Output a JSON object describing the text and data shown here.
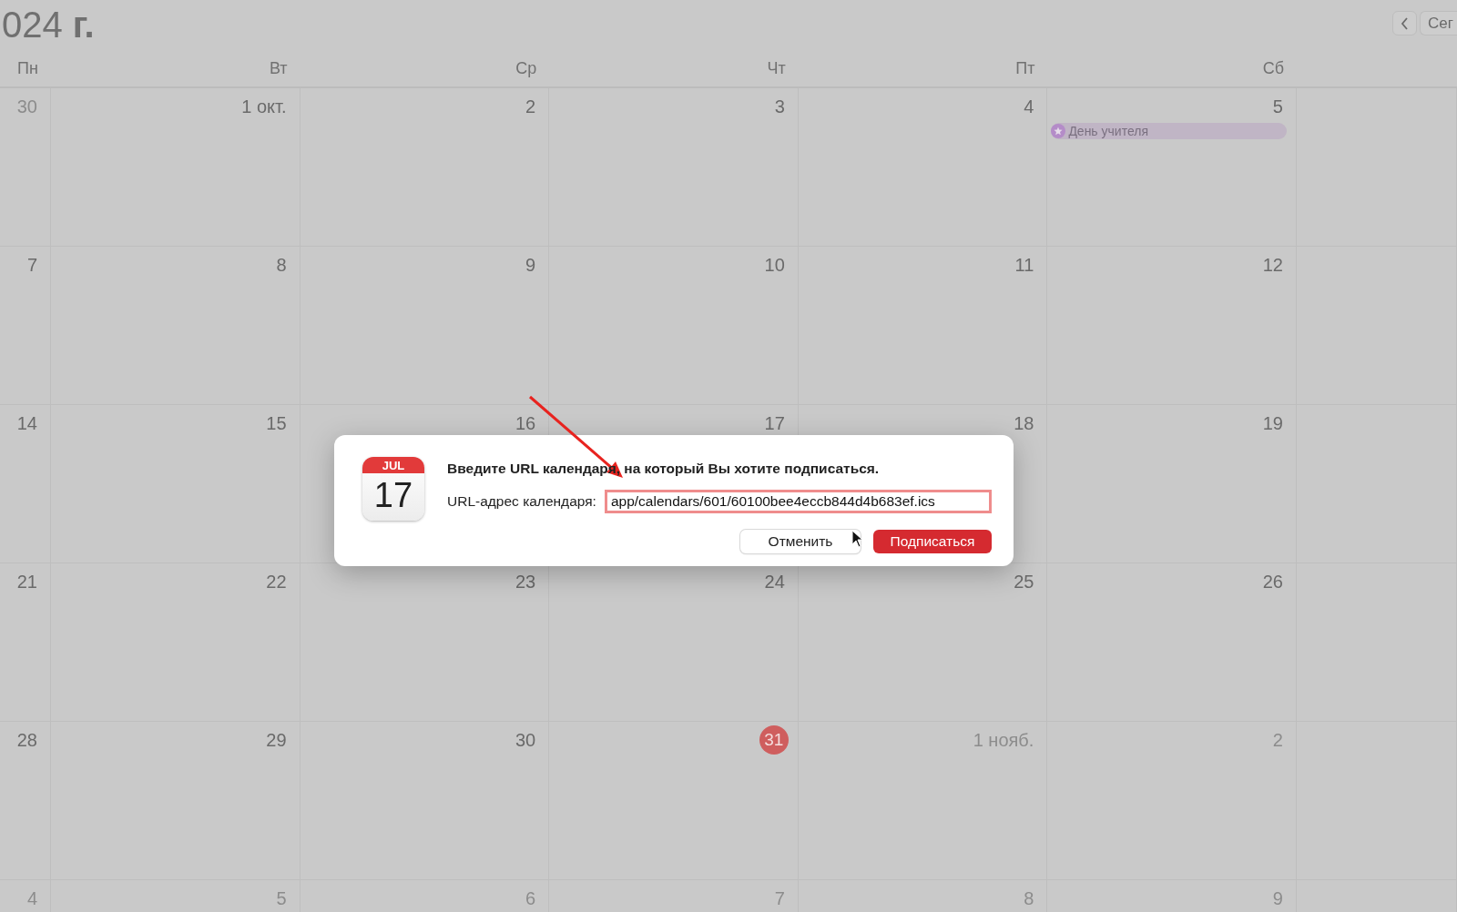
{
  "toolbar": {
    "title": "024 **г.**",
    "today_button": "Сег"
  },
  "weekdays": [
    {
      "label": "Пн"
    },
    {
      "label": "Вт"
    },
    {
      "label": "Ср"
    },
    {
      "label": "Чт"
    },
    {
      "label": "Пт"
    },
    {
      "label": "Сб"
    }
  ],
  "weeks": [
    {
      "days": [
        {
          "label": "30",
          "outside": true,
          "today": false
        },
        {
          "label": "1 окт.",
          "outside": false,
          "today": false
        },
        {
          "label": "2",
          "outside": false,
          "today": false
        },
        {
          "label": "3",
          "outside": false,
          "today": false
        },
        {
          "label": "4",
          "outside": false,
          "today": false
        },
        {
          "label": "5",
          "outside": false,
          "today": false,
          "events": [
            {
              "title": "День учителя",
              "color": "#b48cc8"
            }
          ]
        }
      ]
    },
    {
      "days": [
        {
          "label": "7",
          "outside": false,
          "today": false
        },
        {
          "label": "8",
          "outside": false,
          "today": false
        },
        {
          "label": "9",
          "outside": false,
          "today": false
        },
        {
          "label": "10",
          "outside": false,
          "today": false
        },
        {
          "label": "11",
          "outside": false,
          "today": false
        },
        {
          "label": "12",
          "outside": false,
          "today": false
        }
      ]
    },
    {
      "days": [
        {
          "label": "14",
          "outside": false,
          "today": false
        },
        {
          "label": "15",
          "outside": false,
          "today": false
        },
        {
          "label": "16",
          "outside": false,
          "today": false
        },
        {
          "label": "17",
          "outside": false,
          "today": false
        },
        {
          "label": "18",
          "outside": false,
          "today": false
        },
        {
          "label": "19",
          "outside": false,
          "today": false
        }
      ]
    },
    {
      "days": [
        {
          "label": "21",
          "outside": false,
          "today": false
        },
        {
          "label": "22",
          "outside": false,
          "today": false
        },
        {
          "label": "23",
          "outside": false,
          "today": false
        },
        {
          "label": "24",
          "outside": false,
          "today": false
        },
        {
          "label": "25",
          "outside": false,
          "today": false
        },
        {
          "label": "26",
          "outside": false,
          "today": false
        }
      ]
    },
    {
      "days": [
        {
          "label": "28",
          "outside": false,
          "today": false
        },
        {
          "label": "29",
          "outside": false,
          "today": false
        },
        {
          "label": "30",
          "outside": false,
          "today": false
        },
        {
          "label": "31",
          "outside": false,
          "today": true
        },
        {
          "label": "1 нояб.",
          "outside": true,
          "today": false
        },
        {
          "label": "2",
          "outside": true,
          "today": false
        }
      ]
    },
    {
      "days": [
        {
          "label": "4",
          "outside": true,
          "today": false
        },
        {
          "label": "5",
          "outside": true,
          "today": false
        },
        {
          "label": "6",
          "outside": true,
          "today": false
        },
        {
          "label": "7",
          "outside": true,
          "today": false
        },
        {
          "label": "8",
          "outside": true,
          "today": false
        },
        {
          "label": "9",
          "outside": true,
          "today": false
        }
      ]
    }
  ],
  "dialog": {
    "icon": {
      "month": "JUL",
      "day": "17"
    },
    "message": "Введите URL календаря, на который Вы хотите подписаться.",
    "field_label": "URL-адрес календаря:",
    "field_value": "app/calendars/601/60100bee4eccb844d4b683ef.ics",
    "focused": true,
    "buttons": [
      {
        "label": "Отменить",
        "kind": "secondary"
      },
      {
        "label": "Подписаться",
        "kind": "primary"
      }
    ]
  }
}
